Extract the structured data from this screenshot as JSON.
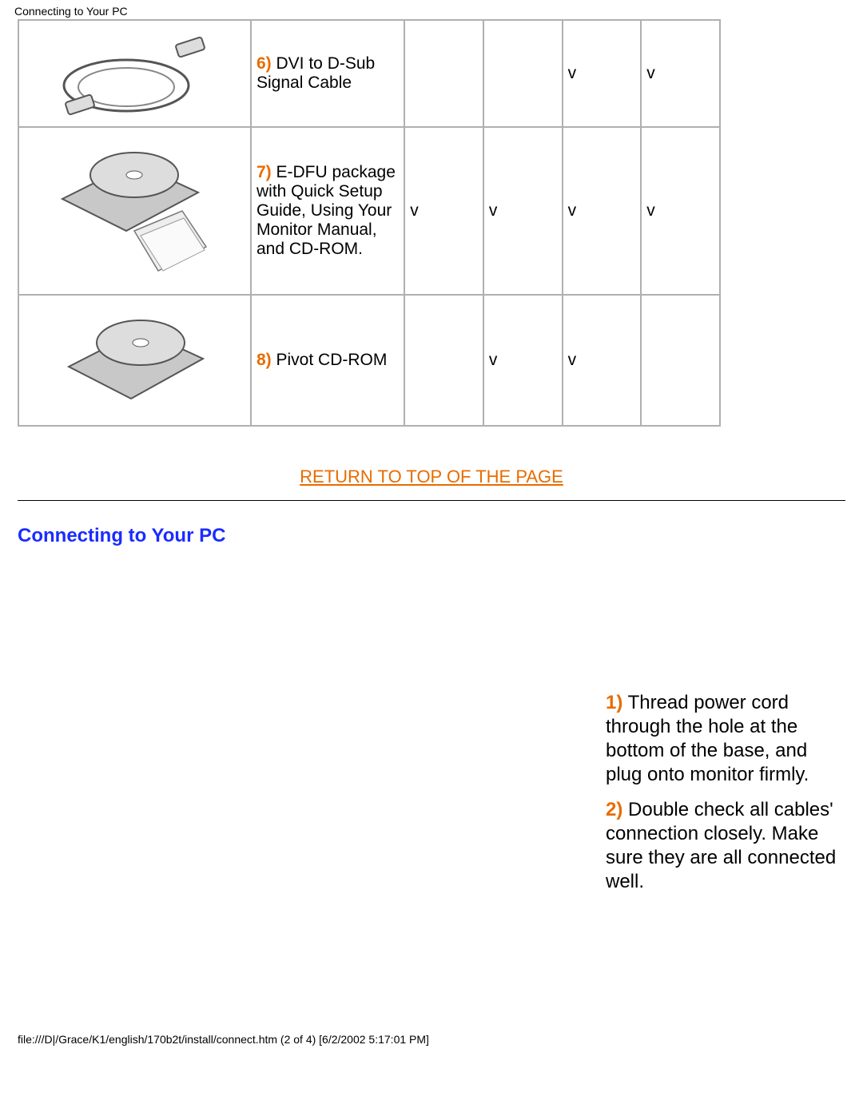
{
  "page_title_small": "Connecting to Your PC",
  "table_rows": [
    {
      "num": "6)",
      "label": " DVI to D-Sub Signal Cable",
      "checks": [
        "",
        "",
        "v",
        "v"
      ]
    },
    {
      "num": "7)",
      "label": " E-DFU package with Quick Setup Guide, Using Your Monitor Manual, and CD-ROM.",
      "checks": [
        "v",
        "v",
        "v",
        "v"
      ]
    },
    {
      "num": "8)",
      "label": " Pivot CD-ROM",
      "checks": [
        "",
        "v",
        "v",
        ""
      ]
    }
  ],
  "return_link": "RETURN TO TOP OF THE PAGE",
  "section_title": "Connecting to Your PC",
  "steps": [
    {
      "num": "1)",
      "text": " Thread power cord through the hole at the bottom of the base, and plug onto monitor firmly."
    },
    {
      "num": "2)",
      "text": " Double check all cables' connection closely. Make sure they are all connected well."
    }
  ],
  "footer": "file:///D|/Grace/K1/english/170b2t/install/connect.htm (2 of 4) [6/2/2002 5:17:01 PM]"
}
